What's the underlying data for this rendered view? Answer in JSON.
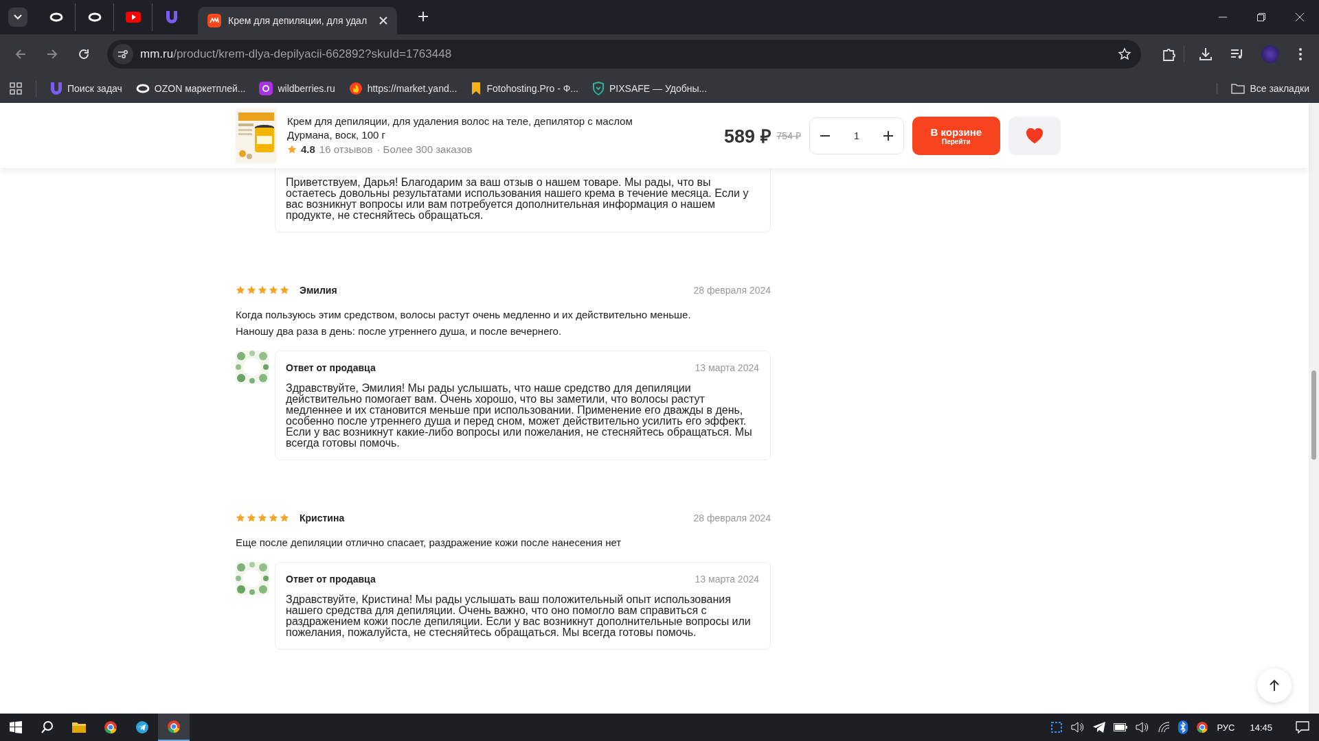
{
  "browser": {
    "tabs": [
      {
        "kind": "ring",
        "selected": false
      },
      {
        "kind": "ring",
        "selected": false
      },
      {
        "kind": "video",
        "selected": false
      },
      {
        "kind": "shield",
        "selected": false
      },
      {
        "kind": "site",
        "title": "Крем для депиляции, для удал",
        "selected": true
      }
    ],
    "url": {
      "host": "mm.ru",
      "path": "/product/krem-dlya-depilyacii-662892?skuId=1763448"
    },
    "bookmarks": [
      {
        "kind": "shield",
        "label": "Поиск задач"
      },
      {
        "kind": "ring",
        "label": "OZON маркетплей..."
      },
      {
        "kind": "wb",
        "label": "wildberries.ru"
      },
      {
        "kind": "flame",
        "label": "https://market.yand..."
      },
      {
        "kind": "letter",
        "label": "Fotohosting.Pro - Ф..."
      },
      {
        "kind": "badge",
        "label": "PIXSAFE — Удобны..."
      }
    ],
    "all_bookmarks": "Все закладки"
  },
  "product_bar": {
    "title": "Крем для депиляции, для удаления волос на теле, депилятор с маслом Дурмана, воск, 100 г",
    "rating": "4.8",
    "reviews": "16 отзывов",
    "orders": "· Более 300 заказов",
    "price": "589 ₽",
    "old_price": "754 ₽",
    "quantity": "1",
    "cart_button": "В корзине",
    "cart_sub": "Перейти",
    "favorite": true
  },
  "partial_reply": {
    "text": "Приветствуем, Дарья! Благодарим за ваш отзыв о нашем товаре. Мы рады, что вы остаетесь довольны результатами использования нашего крема в течение месяца. Если у вас возникнут вопросы или вам потребуется дополнительная информация о нашем продукте, не стесняйтесь обращаться."
  },
  "reviews": [
    {
      "stars": 5,
      "author": "Эмилия",
      "date": "28 февраля 2024",
      "paragraphs": [
        "Когда пользуюсь этим средством, волосы растут очень медленно и их действительно меньше.",
        "Наношу два раза в день: после утреннего душа, и после вечернего."
      ],
      "reply": {
        "title": "Ответ от продавца",
        "date": "13 марта 2024",
        "text": "Здравствуйте, Эмилия! Мы рады услышать, что наше средство для депиляции действительно помогает вам. Очень хорошо, что вы заметили, что волосы растут медленнее и их становится меньше при использовании. Применение его дважды в день, особенно после утреннего душа и перед сном, может действительно усилить его эффект. Если у вас возникнут какие-либо вопросы или пожелания, не стесняйтесь обращаться. Мы всегда готовы помочь."
      }
    },
    {
      "stars": 5,
      "author": "Кристина",
      "date": "28 февраля 2024",
      "paragraphs": [
        "Еще после депиляции отлично спасает, раздражение кожи после нанесения нет"
      ],
      "reply": {
        "title": "Ответ от продавца",
        "date": "13 марта 2024",
        "text": "Здравствуйте, Кристина! Мы рады услышать ваш положительный опыт использования нашего средства для депиляции. Очень важно, что оно помогло вам справиться с раздражением кожи после депиляции. Если у вас возникнут дополнительные вопросы или пожелания, пожалуйста, не стесняйтесь обращаться. Мы всегда готовы помочь."
      }
    }
  ],
  "taskbar": {
    "language": "РУС",
    "time": "14:45"
  }
}
